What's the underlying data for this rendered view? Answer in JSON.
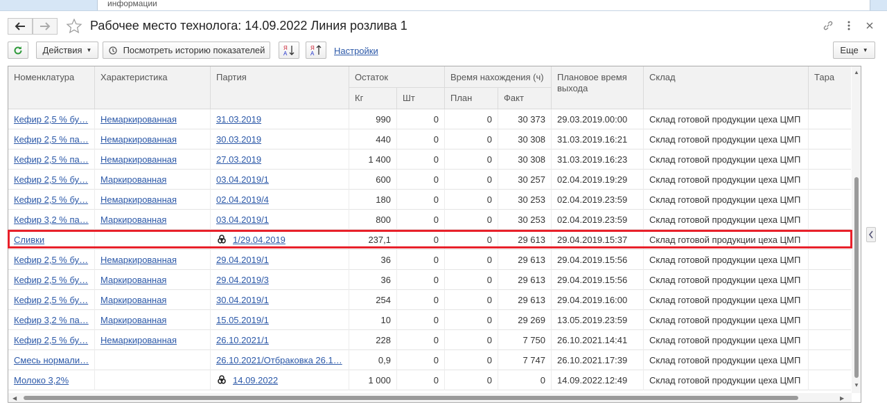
{
  "top_tab": {
    "label": "информации"
  },
  "window": {
    "title": "Рабочее место технолога: 14.09.2022 Линия розлива 1"
  },
  "toolbar": {
    "actions_label": "Действия",
    "history_label": "Посмотреть историю показателей",
    "settings_label": "Настройки",
    "more_label": "Еще",
    "sort_asc_label": "Я А",
    "sort_desc_label": "Я А"
  },
  "columns": {
    "nomenclature": "Номенклатура",
    "characteristic": "Характеристика",
    "batch": "Партия",
    "remainder": "Остаток",
    "kg": "Кг",
    "pcs": "Шт",
    "time_in": "Время нахождения (ч)",
    "plan": "План",
    "fact": "Факт",
    "planned_exit": "Плановое время выхода",
    "warehouse": "Склад",
    "tare": "Тара"
  },
  "rows": [
    {
      "nom": "Кефир 2,5 % бу…",
      "char": "Немаркированная",
      "batch": "31.03.2019",
      "bio": false,
      "kg": "990",
      "pcs": "0",
      "plan": "0",
      "fact": "30 373",
      "exit": "29.03.2019.00:00",
      "wh": "Склад готовой продукции цеха ЦМП"
    },
    {
      "nom": "Кефир 2,5 % па…",
      "char": "Немаркированная",
      "batch": "30.03.2019",
      "bio": false,
      "kg": "440",
      "pcs": "0",
      "plan": "0",
      "fact": "30 308",
      "exit": "31.03.2019.16:21",
      "wh": "Склад готовой продукции цеха ЦМП"
    },
    {
      "nom": "Кефир 2,5 % па…",
      "char": "Немаркированная",
      "batch": "27.03.2019",
      "bio": false,
      "kg": "1 400",
      "pcs": "0",
      "plan": "0",
      "fact": "30 308",
      "exit": "31.03.2019.16:23",
      "wh": "Склад готовой продукции цеха ЦМП"
    },
    {
      "nom": "Кефир 2,5 % бу…",
      "char": "Маркированная",
      "batch": "03.04.2019/1",
      "bio": false,
      "kg": "600",
      "pcs": "0",
      "plan": "0",
      "fact": "30 257",
      "exit": "02.04.2019.19:29",
      "wh": "Склад готовой продукции цеха ЦМП"
    },
    {
      "nom": "Кефир 2,5 % бу…",
      "char": "Немаркированная",
      "batch": "02.04.2019/4",
      "bio": false,
      "kg": "180",
      "pcs": "0",
      "plan": "0",
      "fact": "30 253",
      "exit": "02.04.2019.23:59",
      "wh": "Склад готовой продукции цеха ЦМП"
    },
    {
      "nom": "Кефир 3,2 % па…",
      "char": "Маркированная",
      "batch": "03.04.2019/1",
      "bio": false,
      "kg": "800",
      "pcs": "0",
      "plan": "0",
      "fact": "30 253",
      "exit": "02.04.2019.23:59",
      "wh": "Склад готовой продукции цеха ЦМП"
    },
    {
      "nom": "Сливки",
      "char": "",
      "batch": "1/29.04.2019",
      "bio": true,
      "kg": "237,1",
      "pcs": "0",
      "plan": "0",
      "fact": "29 613",
      "exit": "29.04.2019.15:37",
      "wh": "Склад готовой продукции цеха ЦМП"
    },
    {
      "nom": "Кефир 2,5 % бу…",
      "char": "Немаркированная",
      "batch": "29.04.2019/1",
      "bio": false,
      "kg": "36",
      "pcs": "0",
      "plan": "0",
      "fact": "29 613",
      "exit": "29.04.2019.15:56",
      "wh": "Склад готовой продукции цеха ЦМП"
    },
    {
      "nom": "Кефир 2,5 % бу…",
      "char": "Маркированная",
      "batch": "29.04.2019/3",
      "bio": false,
      "kg": "36",
      "pcs": "0",
      "plan": "0",
      "fact": "29 613",
      "exit": "29.04.2019.15:56",
      "wh": "Склад готовой продукции цеха ЦМП"
    },
    {
      "nom": "Кефир 2,5 % бу…",
      "char": "Маркированная",
      "batch": "30.04.2019/1",
      "bio": false,
      "kg": "254",
      "pcs": "0",
      "plan": "0",
      "fact": "29 613",
      "exit": "29.04.2019.16:00",
      "wh": "Склад готовой продукции цеха ЦМП"
    },
    {
      "nom": "Кефир 3,2 % па…",
      "char": "Маркированная",
      "batch": "15.05.2019/1",
      "bio": false,
      "kg": "10",
      "pcs": "0",
      "plan": "0",
      "fact": "29 269",
      "exit": "13.05.2019.23:59",
      "wh": "Склад готовой продукции цеха ЦМП"
    },
    {
      "nom": "Кефир 2,5 % бу…",
      "char": "Немаркированная",
      "batch": "26.10.2021/1",
      "bio": false,
      "kg": "228",
      "pcs": "0",
      "plan": "0",
      "fact": "7 750",
      "exit": "26.10.2021.14:41",
      "wh": "Склад готовой продукции цеха ЦМП"
    },
    {
      "nom": "Смесь нормали…",
      "char": "",
      "batch": "26.10.2021/Отбраковка 26.1…",
      "bio": false,
      "kg": "0,9",
      "pcs": "0",
      "plan": "0",
      "fact": "7 747",
      "exit": "26.10.2021.17:39",
      "wh": "Склад готовой продукции цеха ЦМП"
    },
    {
      "nom": "Молоко 3,2%",
      "char": "",
      "batch": "14.09.2022",
      "bio": true,
      "kg": "1 000",
      "pcs": "0",
      "plan": "0",
      "fact": "0",
      "exit": "14.09.2022.12:49",
      "wh": "Склад готовой продукции цеха ЦМП"
    }
  ]
}
